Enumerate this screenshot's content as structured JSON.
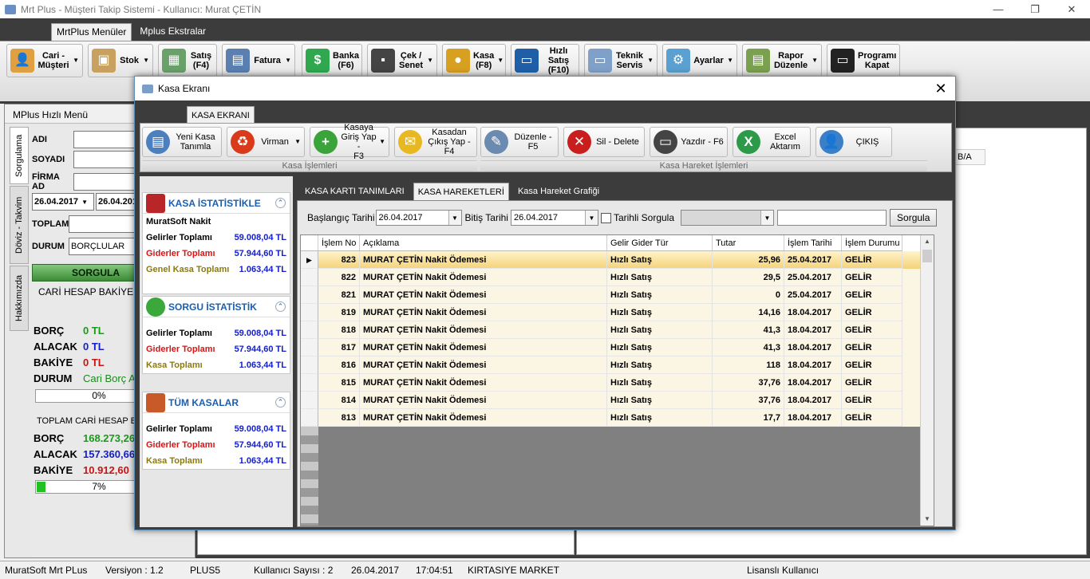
{
  "window": {
    "title": "Mrt Plus - Müşteri Takip Sistemi - Kullanıcı: Murat ÇETİN",
    "controls": {
      "minimize": "—",
      "maximize": "❐",
      "close": "✕"
    }
  },
  "main_tabs": [
    "MrtPlus Menüler",
    "Mplus Ekstralar"
  ],
  "main_ribbon": [
    {
      "label": "Cari -\nMüşteri",
      "icon": "person-icon",
      "color": "#e0a040",
      "dropdown": true
    },
    {
      "label": "Stok",
      "icon": "boxes-icon",
      "color": "#c8a060",
      "dropdown": true
    },
    {
      "label": "Satış\n(F4)",
      "icon": "calculator-icon",
      "color": "#6aa06a",
      "dropdown": false
    },
    {
      "label": "Fatura",
      "icon": "invoice-icon",
      "color": "#5a7fb0",
      "dropdown": true
    },
    {
      "label": "Banka\n(F6)",
      "icon": "dollar-icon",
      "color": "#2fa84f",
      "dropdown": false
    },
    {
      "label": "Çek /\nSenet",
      "icon": "floppy-icon",
      "color": "#444444",
      "dropdown": true
    },
    {
      "label": "Kasa\n(F8)",
      "icon": "coins-icon",
      "color": "#d8a020",
      "dropdown": true
    },
    {
      "label": "Hızlı\nSatış\n(F10)",
      "icon": "monitor-icon",
      "color": "#1f5fa8",
      "dropdown": false
    },
    {
      "label": "Teknik\nServis",
      "icon": "screen-icon",
      "color": "#7fa0c8",
      "dropdown": true
    },
    {
      "label": "Ayarlar",
      "icon": "gears-icon",
      "color": "#5aa0d0",
      "dropdown": true
    },
    {
      "label": "Rapor\nDüzenle",
      "icon": "report-icon",
      "color": "#7aa050",
      "dropdown": true
    },
    {
      "label": "Programı\nKapat",
      "icon": "power-monitor-icon",
      "color": "#222222",
      "dropdown": false
    }
  ],
  "quick_menu": {
    "title": "MPlus Hızlı Menü",
    "vertical_tabs": [
      "Sorgulama",
      "Döviz - Takvim",
      "Hakkımızda"
    ],
    "fields": {
      "adi": "ADI",
      "soyadi": "SOYADI",
      "firma": "FİRMA AD",
      "toplam": "TOPLAM",
      "durum": "DURUM"
    },
    "date_from": "26.04.2017",
    "date_to": "26.04.2017",
    "durum_value": "BORÇLULAR",
    "sorgula": "SORGULA",
    "cari_label": "CARİ HESAP BAKİYESİ",
    "borc_label": "BORÇ",
    "borc_value": "0 TL",
    "alacak_label": "ALACAK",
    "alacak_value": "0 TL",
    "bakiye_label": "BAKİYE",
    "bakiye_value": "0 TL",
    "durum_label": "DURUM",
    "durum_text": "Cari Borç A",
    "progress1": "0%",
    "progress1_value": 0,
    "toplam_label": "TOPLAM CARİ HESAP BA",
    "t_borc": "168.273,26",
    "t_alacak": "157.360,66",
    "t_bakiye": "10.912,60",
    "progress2": "7%",
    "progress2_value": 7
  },
  "bg_fragment": "B/A",
  "status": {
    "app": "MuratSoft Mrt PLus",
    "version": "Versiyon : 1.2",
    "plus": "PLUS5",
    "users": "Kullanıcı Sayısı : 2",
    "date": "26.04.2017",
    "time": "17:04:51",
    "shop": "KIRTASIYE MARKET",
    "license": "Lisanslı Kullanıcı"
  },
  "dialog": {
    "title": "Kasa Ekranı",
    "close": "✕",
    "tab": "KASA EKRANI",
    "buttons": [
      {
        "label": "Yeni Kasa\nTanımla",
        "icon": "id-card-icon",
        "color": "#4a7fc0",
        "dropdown": false
      },
      {
        "label": "Virman",
        "icon": "recycle-icon",
        "color": "#d83a1a",
        "dropdown": true
      },
      {
        "label": "Kasaya\nGiriş Yap -\nF3",
        "icon": "plus-icon",
        "color": "#3aa43a",
        "dropdown": true
      },
      {
        "label": "Kasadan\nÇıkış Yap -\nF4",
        "icon": "envelope-icon",
        "color": "#e8b820",
        "dropdown": false
      },
      {
        "label": "Düzenle -\nF5",
        "icon": "edit-icon",
        "color": "#6a8ab0",
        "dropdown": false
      },
      {
        "label": "Sil - Delete",
        "icon": "delete-icon",
        "color": "#c81e1e",
        "dropdown": false
      },
      {
        "label": "Yazdır - F6",
        "icon": "printer-icon",
        "color": "#444444",
        "dropdown": false
      },
      {
        "label": "Excel\nAktarım",
        "icon": "excel-icon",
        "color": "#2d9a4a",
        "dropdown": false
      },
      {
        "label": "ÇIKIŞ",
        "icon": "user-exit-icon",
        "color": "#3a7fc8",
        "dropdown": false
      }
    ],
    "group1": "Kasa İşlemleri",
    "group2": "Kasa Hareket İşlemleri",
    "stats": {
      "kasa": {
        "title": "KASA İSTATİSTİKLE",
        "name": "MuratSoft Nakit",
        "gelir_label": "Gelirler Toplamı",
        "gelir": "59.008,04 TL",
        "gider_label": "Giderler Toplamı",
        "gider": "57.944,60 TL",
        "genel_label": "Genel Kasa Toplamı",
        "genel": "1.063,44 TL"
      },
      "sorgu": {
        "title": "SORGU İSTATİSTİK",
        "gelir_label": "Gelirler Toplamı",
        "gelir": "59.008,04 TL",
        "gider_label": "Giderler Toplamı",
        "gider": "57.944,60 TL",
        "kasa_label": "Kasa Toplamı",
        "kasa": "1.063,44 TL"
      },
      "tum": {
        "title": "TÜM KASALAR",
        "gelir_label": "Gelirler Toplamı",
        "gelir": "59.008,04 TL",
        "gider_label": "Giderler Toplamı",
        "gider": "57.944,60 TL",
        "kasa_label": "Kasa Toplamı",
        "kasa": "1.063,44 TL"
      }
    },
    "inner_tabs": [
      "KASA KARTI TANIMLARI",
      "KASA HAREKETLERİ",
      "Kasa Hareket Grafiği"
    ],
    "filter": {
      "start_label": "Başlangıç Tarihi",
      "start": "26.04.2017",
      "end_label": "Bitiş Tarihi",
      "end": "26.04.2017",
      "tarihli": "Tarihli Sorgula",
      "combo": "",
      "search": "",
      "button": "Sorgula"
    },
    "grid": {
      "columns": [
        "İşlem No",
        "Açıklama",
        "Gelir Gider Tür",
        "Tutar",
        "İşlem Tarihi",
        "İşlem Durumu"
      ],
      "rows": [
        [
          "823",
          "MURAT ÇETİN Nakit Ödemesi",
          "Hızlı Satış",
          "25,96",
          "25.04.2017",
          "GELİR"
        ],
        [
          "822",
          "MURAT ÇETİN Nakit Ödemesi",
          "Hızlı Satış",
          "29,5",
          "25.04.2017",
          "GELİR"
        ],
        [
          "821",
          "MURAT ÇETİN Nakit Ödemesi",
          "Hızlı Satış",
          "0",
          "25.04.2017",
          "GELİR"
        ],
        [
          "819",
          "MURAT ÇETİN Nakit Ödemesi",
          "Hızlı Satış",
          "14,16",
          "18.04.2017",
          "GELİR"
        ],
        [
          "818",
          "MURAT ÇETİN Nakit Ödemesi",
          "Hızlı Satış",
          "41,3",
          "18.04.2017",
          "GELİR"
        ],
        [
          "817",
          "MURAT ÇETİN Nakit Ödemesi",
          "Hızlı Satış",
          "41,3",
          "18.04.2017",
          "GELİR"
        ],
        [
          "816",
          "MURAT ÇETİN Nakit Ödemesi",
          "Hızlı Satış",
          "118",
          "18.04.2017",
          "GELİR"
        ],
        [
          "815",
          "MURAT ÇETİN Nakit Ödemesi",
          "Hızlı Satış",
          "37,76",
          "18.04.2017",
          "GELİR"
        ],
        [
          "814",
          "MURAT ÇETİN Nakit Ödemesi",
          "Hızlı Satış",
          "37,76",
          "18.04.2017",
          "GELİR"
        ],
        [
          "813",
          "MURAT ÇETİN Nakit Ödemesi",
          "Hızlı Satış",
          "17,7",
          "18.04.2017",
          "GELİR"
        ]
      ],
      "current_marker": "▶"
    }
  }
}
